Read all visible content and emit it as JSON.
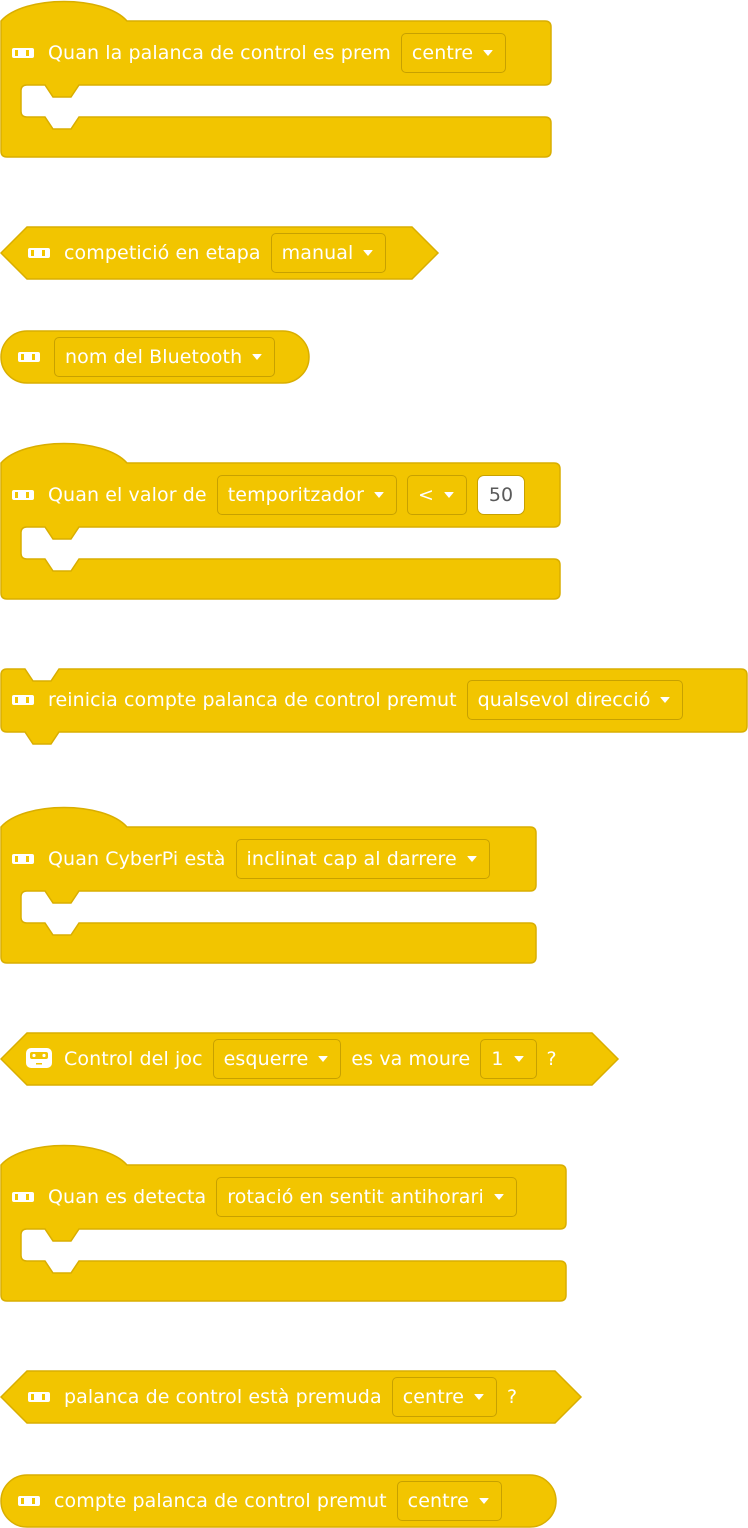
{
  "colors": {
    "block_fill": "#F2C500",
    "block_stroke": "#D9AE00",
    "text": "#FFFFFF"
  },
  "blocks": [
    {
      "icon": "cyberpi-joystick-icon",
      "text": "Quan la palanca de control es prem",
      "dropdown": "centre"
    },
    {
      "icon": "cyberpi-joystick-icon",
      "text": "competició en etapa",
      "dropdown": "manual"
    },
    {
      "icon": "cyberpi-joystick-icon",
      "dropdown": "nom del Bluetooth"
    },
    {
      "icon": "cyberpi-joystick-icon",
      "text": "Quan el valor de",
      "dropdown": "temporitzador",
      "operator": "<",
      "value": "50"
    },
    {
      "icon": "cyberpi-joystick-icon",
      "text": "reinicia compte palanca de control premut",
      "dropdown": "qualsevol direcció"
    },
    {
      "icon": "cyberpi-joystick-icon",
      "text": "Quan CyberPi està",
      "dropdown": "inclinat cap al darrere"
    },
    {
      "icon": "game-controller-icon",
      "text": "Control del joc",
      "dropdown": "esquerre",
      "text2": "es va moure",
      "dropdown2": "1",
      "suffix": "?"
    },
    {
      "icon": "cyberpi-joystick-icon",
      "text": "Quan es detecta",
      "dropdown": "rotació en sentit antihorari"
    },
    {
      "icon": "cyberpi-joystick-icon",
      "text": "palanca de control està premuda",
      "dropdown": "centre",
      "suffix": "?"
    },
    {
      "icon": "cyberpi-joystick-icon",
      "text": "compte palanca de control premut",
      "dropdown": "centre"
    }
  ]
}
